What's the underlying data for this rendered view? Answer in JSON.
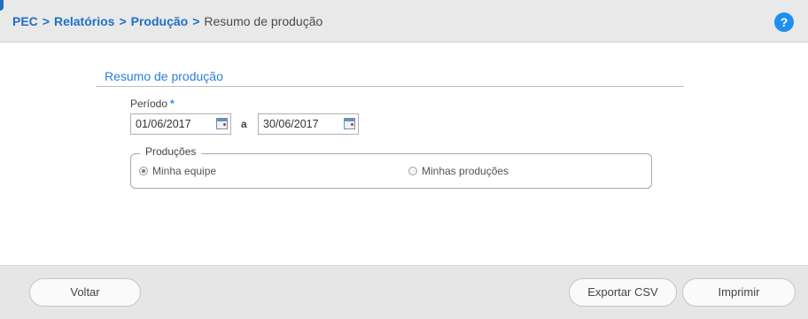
{
  "breadcrumb": {
    "items": [
      "PEC",
      "Relatórios",
      "Produção"
    ],
    "separator": ">",
    "current": "Resumo de produção"
  },
  "help": {
    "label": "?",
    "icon": "help-icon"
  },
  "form": {
    "section_title": "Resumo de produção",
    "periodo": {
      "label": "Período",
      "required_mark": "*",
      "start_value": "01/06/2017",
      "separator": "a",
      "end_value": "30/06/2017",
      "calendar_icon": "calendar-icon"
    },
    "producoes": {
      "legend": "Produções",
      "options": [
        {
          "label": "Minha equipe",
          "checked": true
        },
        {
          "label": "Minhas produções",
          "checked": false
        }
      ]
    }
  },
  "footer": {
    "back_label": "Voltar",
    "export_label": "Exportar CSV",
    "print_label": "Imprimir"
  },
  "colors": {
    "link": "#1f6fc5",
    "section_title": "#2c7fd6",
    "help_bg": "#1f8ff0",
    "topbar_bg": "#e9e9e9",
    "footer_bg": "#e6e6e6"
  }
}
